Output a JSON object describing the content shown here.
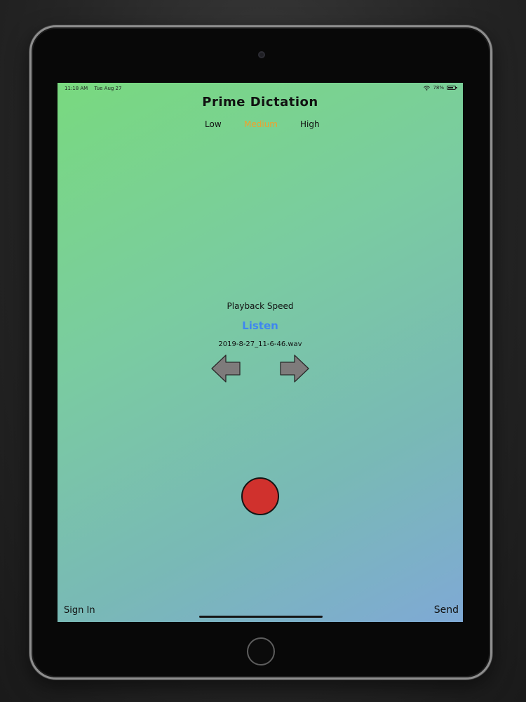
{
  "status_bar": {
    "time": "11:18 AM",
    "date": "Tue Aug 27",
    "battery": "78%",
    "battery_level": 0.78
  },
  "app": {
    "title": "Prime Dictation"
  },
  "quality": {
    "low_label": "Low",
    "medium_label": "Medium",
    "high_label": "High",
    "selected": "Medium",
    "selected_color": "#f1a02c"
  },
  "playback": {
    "speed_label": "Playback Speed",
    "listen_label": "Listen",
    "listen_color": "#3f86f0",
    "filename": "2019-8-27_11-6-46.wav"
  },
  "navigation": {
    "previous_icon": "left-arrow-icon",
    "next_icon": "right-arrow-icon"
  },
  "record": {
    "icon": "record-button",
    "color": "#d0312d"
  },
  "footer": {
    "sign_in_label": "Sign In",
    "send_label": "Send"
  },
  "colors": {
    "gradient_start": "#79d97f",
    "gradient_end": "#7fa9d5"
  }
}
